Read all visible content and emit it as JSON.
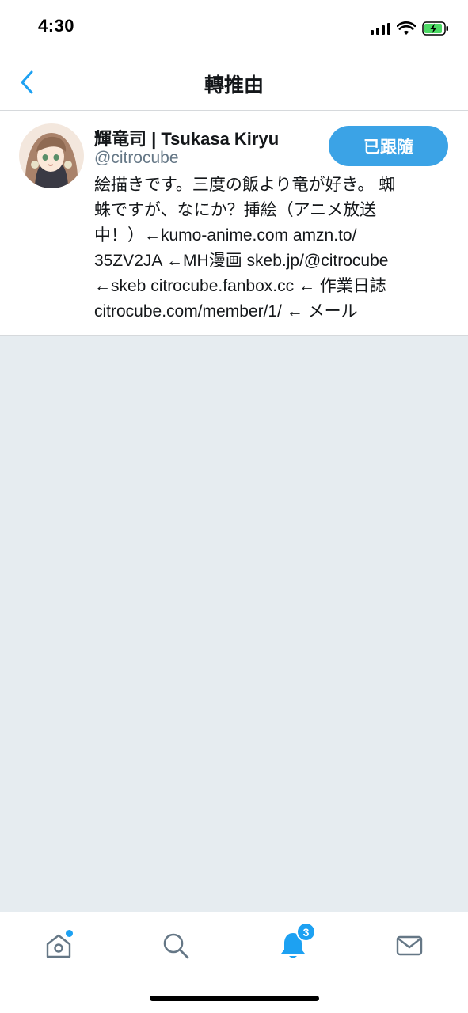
{
  "status_bar": {
    "time": "4:30",
    "icons": [
      "cellular-signal-icon",
      "wifi-icon",
      "battery-charging-icon"
    ]
  },
  "nav": {
    "title": "轉推由",
    "back_icon": "chevron-left-icon"
  },
  "user": {
    "display_name": "輝竜司 | Tsukasa Kiryu",
    "handle": "@citrocube",
    "follow_label": "已跟隨",
    "bio_lines": [
      "絵描きです。三度の飯より竜が好き。 蜘",
      "蛛ですが、なにか？挿絵（アニメ放送",
      "中！）←kumo-anime.com amzn.to/",
      "35ZV2JA ←MH漫画 skeb.jp/@citrocube",
      "←skeb citrocube.fanbox.cc ← 作業日誌",
      "citrocube.com/member/1/ ← メール"
    ]
  },
  "tab_bar": {
    "tabs": [
      "home-icon",
      "search-icon",
      "notifications-icon",
      "messages-icon"
    ],
    "notification_count": "3"
  },
  "colors": {
    "accent": "#1da1f2",
    "follow_button": "#3ba3e6",
    "background_empty": "#e6ecf0",
    "secondary_text": "#657786",
    "divider": "#d6d9dc"
  }
}
